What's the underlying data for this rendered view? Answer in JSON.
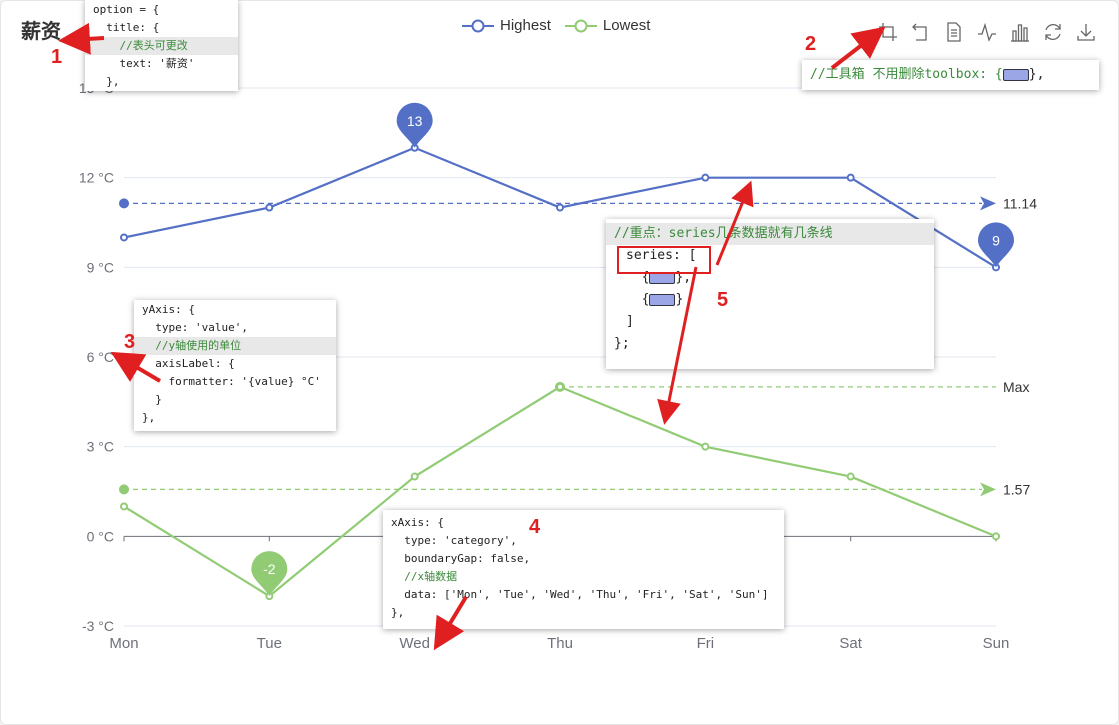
{
  "title": "薪资",
  "colors": {
    "highest": "#5470c6",
    "lowest": "#91cc75",
    "annotation": "#e02020"
  },
  "toolbox": [
    "data-zoom-icon",
    "restore-icon",
    "data-view-icon",
    "line-chart-icon",
    "bar-chart-icon",
    "refresh-icon",
    "save-image-icon"
  ],
  "chart_data": {
    "type": "line",
    "categories": [
      "Mon",
      "Tue",
      "Wed",
      "Thu",
      "Fri",
      "Sat",
      "Sun"
    ],
    "ylim": [
      -3,
      15
    ],
    "yticks": [
      "-3 °C",
      "0 °C",
      "3 °C",
      "6 °C",
      "9 °C",
      "12 °C",
      "15 °C"
    ],
    "yunit": "°C",
    "legend_position": "top-center",
    "series": [
      {
        "name": "Highest",
        "values": [
          10,
          11,
          13,
          11,
          12,
          12,
          9
        ],
        "markPoints": [
          {
            "label": "13",
            "x": "Wed",
            "y": 13
          },
          {
            "label": "9",
            "x": "Sun",
            "y": 9
          }
        ],
        "markLine": {
          "label": "11.14",
          "y": 11.14
        }
      },
      {
        "name": "Lowest",
        "values": [
          1,
          -2,
          2,
          5,
          3,
          2,
          0
        ],
        "markPoints": [
          {
            "label": "-2",
            "x": "Tue",
            "y": -2
          }
        ],
        "markLine": {
          "label": "1.57",
          "y": 1.57
        },
        "maxLine": {
          "label": "Max",
          "x": "Thu",
          "y": 5
        }
      }
    ]
  },
  "annotations": {
    "numbers": [
      "1",
      "2",
      "3",
      "4",
      "5"
    ],
    "title_code": [
      "option = {",
      "  title: {",
      "    //表头可更改",
      "    text: '薪资'",
      "  },"
    ],
    "toolbox_code": [
      "//工具箱 不用删除toolbox: {",
      "},"
    ],
    "yaxis_code": [
      "yAxis: {",
      "  type: 'value',",
      "  //y轴使用的单位",
      "  axisLabel: {",
      "    formatter: '{value} °C'",
      "  }",
      "},"
    ],
    "xaxis_code": [
      "xAxis: {",
      "  type: 'category',",
      "  boundaryGap: false,",
      "  //x轴数据",
      "  data: ['Mon', 'Tue', 'Wed', 'Thu', 'Fri', 'Sat', 'Sun']",
      "},"
    ],
    "series_code": [
      "//重点：series几条数据就有几条线",
      "series: [",
      "  {",
      "},",
      "  {",
      "}",
      "]",
      "};"
    ]
  }
}
